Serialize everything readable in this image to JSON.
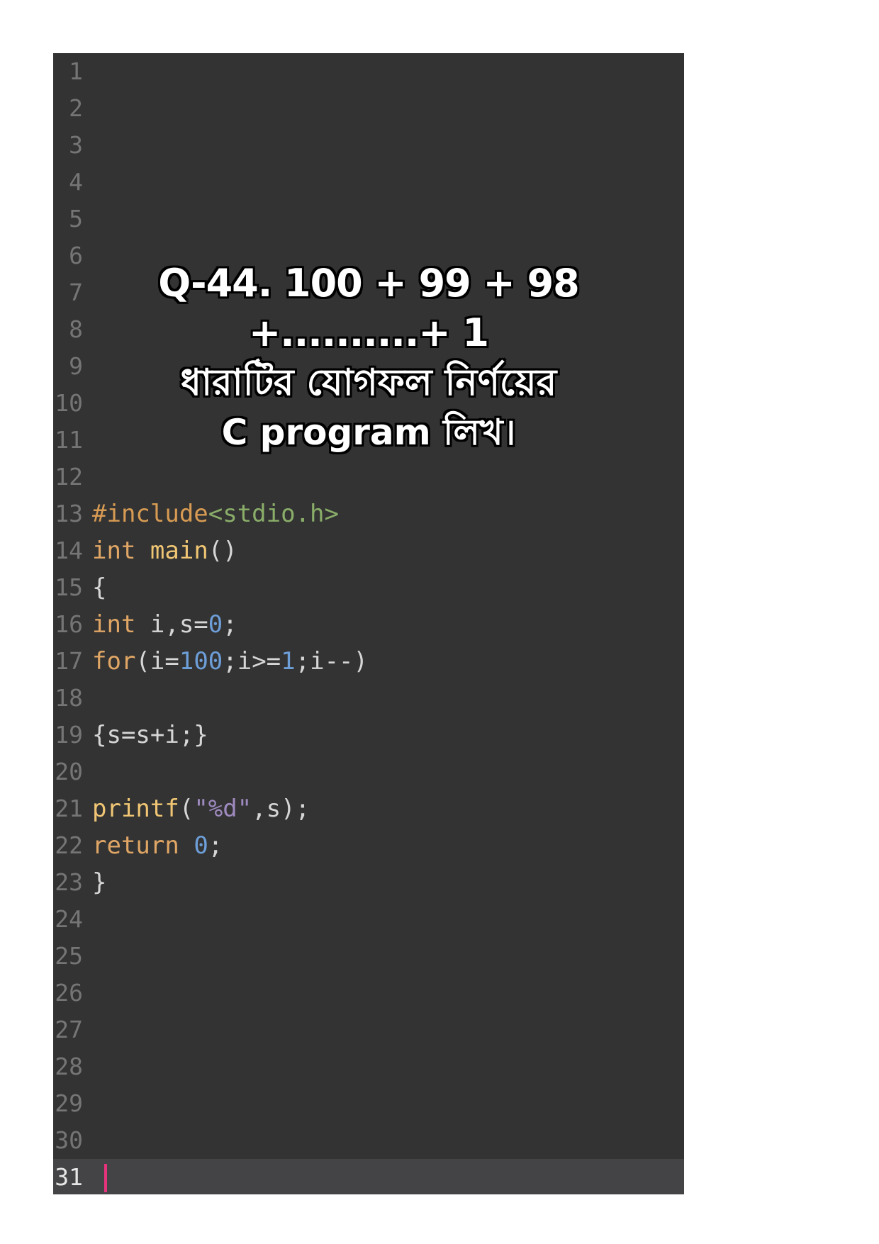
{
  "editor": {
    "line_numbers": [
      "1",
      "2",
      "3",
      "4",
      "5",
      "6",
      "7",
      "8",
      "9",
      "10",
      "11",
      "12",
      "13",
      "14",
      "15",
      "16",
      "17",
      "18",
      "19",
      "20",
      "21",
      "22",
      "23",
      "24",
      "25",
      "26",
      "27",
      "28",
      "29",
      "30",
      "31"
    ],
    "current_line": "31",
    "colors": {
      "background": "#333333",
      "current_line_bg": "#444446",
      "line_number": "#757575",
      "preprocessor": "#d79b53",
      "include_path": "#8aae69",
      "keyword": "#e0a665",
      "function": "#f0c674",
      "number": "#6d9ed8",
      "string": "#9e8abe",
      "text": "#d6d6d6",
      "caret": "#e8337c"
    },
    "code": {
      "l13_pre": "#include",
      "l13_path": "<stdio.h>",
      "l14_kw": "int",
      "l14_fn": "main",
      "l14_rest": "()",
      "l15": "{",
      "l16_kw": "int",
      "l16_a": " i,s=",
      "l16_num": "0",
      "l16_b": ";",
      "l17_kw": "for",
      "l17_a": "(i=",
      "l17_num1": "100",
      "l17_b": ";i>=",
      "l17_num2": "1",
      "l17_c": ";i--)",
      "l19": "{s=s+i;}",
      "l21_fn": "printf",
      "l21_a": "(",
      "l21_str": "\"%d\"",
      "l21_b": ",s);",
      "l22_kw": "return",
      "l22_num": "0",
      "l22_b": ";",
      "l23": "}"
    }
  },
  "overlay": {
    "line1": "Q-44. 100 + 99 + 98 +..........+ 1",
    "line2": "ধারাটির যোগফল নির্ণয়ের",
    "line3": "C program লিখ।"
  }
}
